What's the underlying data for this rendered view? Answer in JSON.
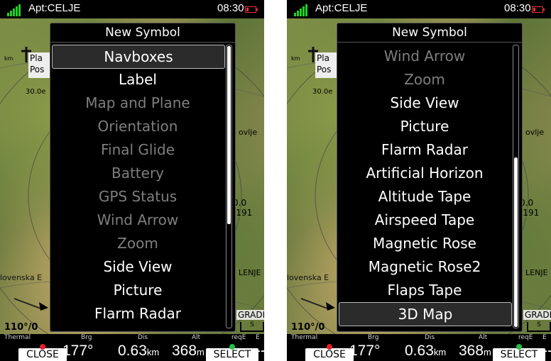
{
  "status_bar": {
    "waypoint": "Apt:CELJE",
    "time": "08:30"
  },
  "map": {
    "info_lines": [
      "Pla",
      "Pos"
    ],
    "dist_label": "km",
    "alt_label": "30.0e",
    "place_right": "ovlje",
    "place_right2": "LENJE",
    "place_left": "lovenska E",
    "gradec": "GRADEC",
    "scale_s": "S",
    "wind_label": "110°/0",
    "alt_top": "0.0",
    "alt_bottom": "-191"
  },
  "navboxes": [
    {
      "title": "Thermal",
      "value": "",
      "unit": ""
    },
    {
      "title": "Brg",
      "value": "177°",
      "unit": ""
    },
    {
      "title": "Dis",
      "value": "0.63",
      "unit": "km"
    },
    {
      "title": "Alt",
      "value": "368",
      "unit": "m"
    },
    {
      "title": "reqE",
      "value": "--",
      "unit": ""
    },
    {
      "title": "E",
      "value": "",
      "unit": ""
    }
  ],
  "buttons": {
    "close": "CLOSE",
    "select": "SELECT"
  },
  "dialog": {
    "title": "New Symbol"
  },
  "screens": [
    {
      "items": [
        {
          "label": "Navboxes",
          "state": "selected"
        },
        {
          "label": "Label",
          "state": "enabled"
        },
        {
          "label": "Map and Plane",
          "state": "disabled"
        },
        {
          "label": "Orientation",
          "state": "disabled"
        },
        {
          "label": "Final Glide",
          "state": "disabled"
        },
        {
          "label": "Battery",
          "state": "disabled"
        },
        {
          "label": "GPS Status",
          "state": "disabled"
        },
        {
          "label": "Wind Arrow",
          "state": "disabled"
        },
        {
          "label": "Zoom",
          "state": "disabled"
        },
        {
          "label": "Side View",
          "state": "enabled"
        },
        {
          "label": "Picture",
          "state": "enabled"
        },
        {
          "label": "Flarm Radar",
          "state": "enabled"
        }
      ],
      "scroll_position": 0.0,
      "scroll_fraction": 0.63
    },
    {
      "items": [
        {
          "label": "Wind Arrow",
          "state": "disabled"
        },
        {
          "label": "Zoom",
          "state": "disabled"
        },
        {
          "label": "Side View",
          "state": "enabled"
        },
        {
          "label": "Picture",
          "state": "enabled"
        },
        {
          "label": "Flarm Radar",
          "state": "enabled"
        },
        {
          "label": "Artificial Horizon",
          "state": "enabled"
        },
        {
          "label": "Altitude Tape",
          "state": "enabled"
        },
        {
          "label": "Airspeed Tape",
          "state": "enabled"
        },
        {
          "label": "Magnetic Rose",
          "state": "enabled"
        },
        {
          "label": "Magnetic Rose2",
          "state": "enabled"
        },
        {
          "label": "Flaps Tape",
          "state": "enabled"
        },
        {
          "label": "3D Map",
          "state": "selected"
        }
      ],
      "scroll_position": 1.0,
      "scroll_fraction": 0.6
    }
  ],
  "colors": {
    "close_dot": "#e0202a",
    "select_dot": "#22c04a",
    "signal": "#1fd12a"
  }
}
